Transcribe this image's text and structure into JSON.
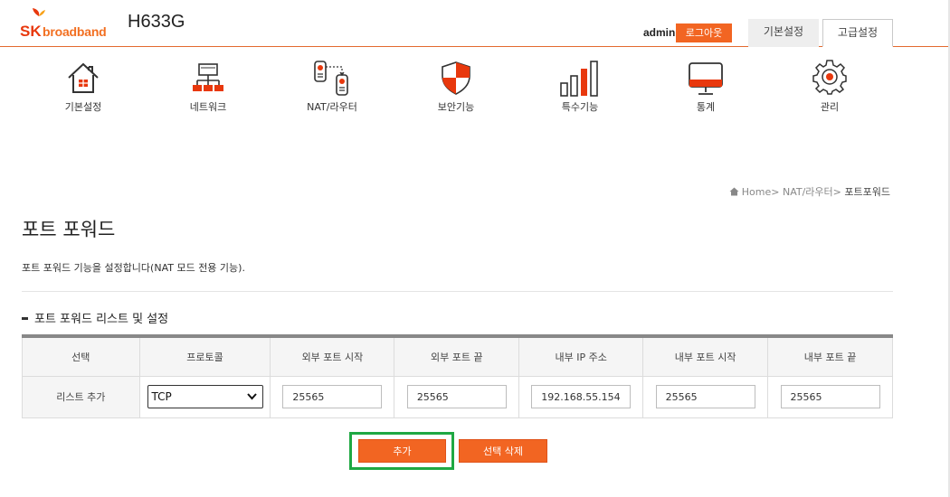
{
  "header": {
    "brand_sk": "SK",
    "brand_broadband": "broadband",
    "model": "H633G",
    "user": "admin",
    "logout_label": "로그아웃",
    "tabs": [
      {
        "label": "기본설정"
      },
      {
        "label": "고급설정"
      }
    ],
    "accent_color": "#f26522"
  },
  "nav": {
    "items": [
      {
        "label": "기본설정",
        "icon": "house-icon"
      },
      {
        "label": "네트워크",
        "icon": "network-icon"
      },
      {
        "label": "NAT/라우터",
        "icon": "router-icon"
      },
      {
        "label": "보안기능",
        "icon": "shield-icon"
      },
      {
        "label": "특수기능",
        "icon": "bar-chart-icon"
      },
      {
        "label": "통계",
        "icon": "monitor-icon"
      },
      {
        "label": "관리",
        "icon": "gear-icon"
      }
    ]
  },
  "breadcrumb": {
    "home": "Home",
    "sep": ">",
    "level1": "NAT/라우터",
    "current": "포트포워드"
  },
  "page": {
    "title": "포트 포워드",
    "description": "포트 포워드 기능을 설정합니다(NAT 모드 전용 기능).",
    "section_title": "포트 포워드 리스트 및 설정"
  },
  "table": {
    "headers": [
      "선택",
      "프로토콜",
      "외부 포트 시작",
      "외부 포트 끝",
      "내부 IP 주소",
      "내부 포트 시작",
      "내부 포트 끝"
    ],
    "row_label": "리스트 추가",
    "protocol": "TCP",
    "ext_port_start": "25565",
    "ext_port_end": "25565",
    "int_ip": "192.168.55.154",
    "int_port_start": "25565",
    "int_port_end": "25565"
  },
  "actions": {
    "add_label": "추가",
    "delete_label": "선택 삭제",
    "focus_color": "#1fa843"
  }
}
